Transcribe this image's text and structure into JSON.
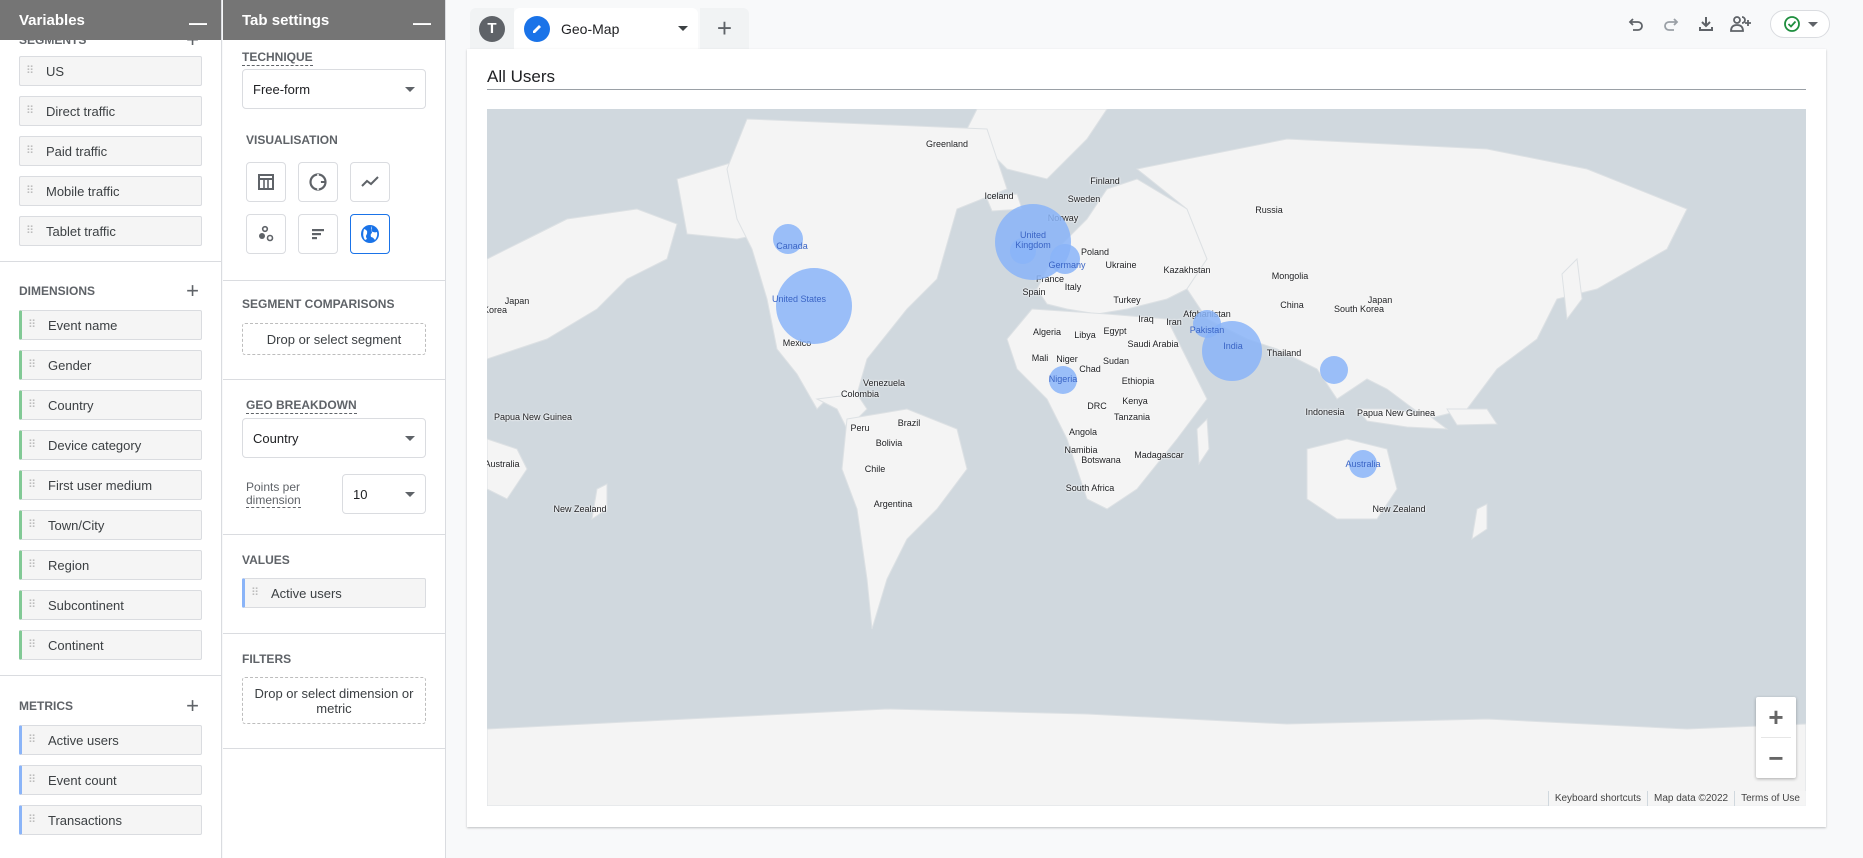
{
  "variables": {
    "title": "Variables",
    "minimize": "—",
    "segments": {
      "label": "Segments",
      "items": [
        "US",
        "Direct traffic",
        "Paid traffic",
        "Mobile traffic",
        "Tablet traffic"
      ]
    },
    "dimensions": {
      "label": "Dimensions",
      "items": [
        "Event name",
        "Gender",
        "Country",
        "Device category",
        "First user medium",
        "Town/City",
        "Region",
        "Subcontinent",
        "Continent"
      ]
    },
    "metrics": {
      "label": "Metrics",
      "items": [
        "Active users",
        "Event count",
        "Transactions"
      ]
    },
    "colors": {
      "dimension_accent": "#81c995",
      "metric_accent": "#8ab4f8"
    }
  },
  "tab_settings": {
    "title": "Tab settings",
    "minimize": "—",
    "technique": {
      "label": "Technique",
      "value": "Free-form"
    },
    "visualisation": {
      "label": "Visualisation",
      "options": [
        "table-icon",
        "donut-chart-icon",
        "line-chart-icon",
        "scatter-plot-icon",
        "bar-chart-icon",
        "geo-map-icon"
      ],
      "selected": "geo-map-icon"
    },
    "segment_comparisons": {
      "label": "Segment comparisons",
      "placeholder": "Drop or select segment"
    },
    "geo_breakdown": {
      "label": "Geo breakdown",
      "value": "Country"
    },
    "points_per_dimension": {
      "label_line1": "Points per",
      "label_line2": "dimension",
      "value": "10"
    },
    "values": {
      "label": "Values",
      "items": [
        "Active users"
      ]
    },
    "filters": {
      "label": "Filters",
      "placeholder": "Drop or select dimension or metric"
    }
  },
  "tabs": {
    "avatar_letter": "T",
    "active_tab": "Geo-Map",
    "add_label": "+"
  },
  "toolbar": {
    "undo": "undo-icon",
    "redo": "redo-icon",
    "download": "download-icon",
    "share": "share-users-icon",
    "status": "saved-check-icon",
    "accent": "#1e8e3e"
  },
  "viz": {
    "title": "All Users",
    "bubble_color": "#8ab4f8",
    "bubbles": [
      {
        "country": "United States",
        "relative_size": 1.0
      },
      {
        "country": "United Kingdom",
        "relative_size": 1.0
      },
      {
        "country": "India",
        "relative_size": 0.8
      },
      {
        "country": "Canada",
        "relative_size": 0.39
      },
      {
        "country": "Germany",
        "relative_size": 0.4
      },
      {
        "country": "Nigeria",
        "relative_size": 0.36
      },
      {
        "country": "Pakistan",
        "relative_size": 0.37
      },
      {
        "country": "Philippines",
        "relative_size": 0.36
      },
      {
        "country": "Australia",
        "relative_size": 0.36
      },
      {
        "country": "Ireland",
        "relative_size": 0.35
      }
    ],
    "map_labels": [
      "Greenland",
      "Iceland",
      "Finland",
      "Sweden",
      "Norway",
      "Russia",
      "Poland",
      "Ukraine",
      "Kazakhstan",
      "Mongolia",
      "China",
      "Japan",
      "South Korea",
      "Korea",
      "Japan",
      "Turkey",
      "Iraq",
      "Iran",
      "Afghanistan",
      "Spain",
      "Italy",
      "France",
      "Algeria",
      "Libya",
      "Egypt",
      "Saudi Arabia",
      "Mali",
      "Niger",
      "Chad",
      "Sudan",
      "Ethiopia",
      "Kenya",
      "DRC",
      "Tanzania",
      "Angola",
      "Namibia",
      "Botswana",
      "South Africa",
      "Madagascar",
      "Thailand",
      "Indonesia",
      "Papua New Guinea",
      "Papua New Guinea",
      "Australia",
      "New Zealand",
      "New Zealand",
      "Mexico",
      "Venezuela",
      "Colombia",
      "Peru",
      "Brazil",
      "Bolivia",
      "Chile",
      "Argentina"
    ],
    "zoom_in": "+",
    "zoom_out": "−",
    "attribution": [
      "Keyboard shortcuts",
      "Map data ©2022",
      "Terms of Use"
    ]
  }
}
